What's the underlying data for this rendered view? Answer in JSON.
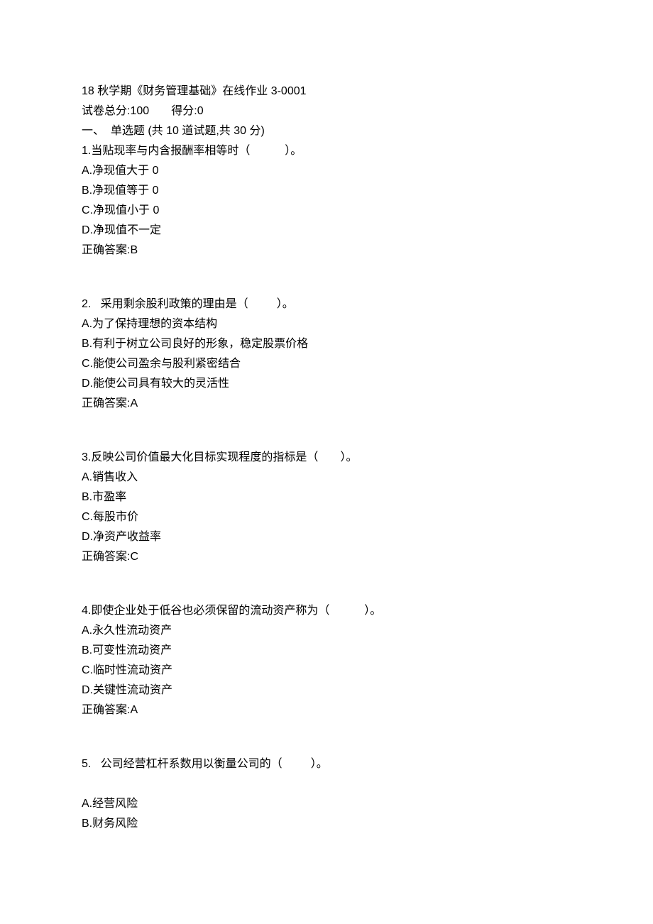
{
  "header": {
    "title": "18 秋学期《财务管理基础》在线作业 3-0001",
    "score_line": "试卷总分:100       得分:0",
    "section_line": "一、  单选题 (共 10 道试题,共 30 分)"
  },
  "questions": [
    {
      "stem": "1.当贴现率与内含报酬率相等时（           ）。",
      "options": [
        "A.净现值大于 0",
        "B.净现值等于 0",
        "C.净现值小于 0",
        "D.净现值不一定"
      ],
      "answer": "正确答案:B"
    },
    {
      "stem": "2.   采用剩余股利政策的理由是（         ）。",
      "options": [
        "A.为了保持理想的资本结构",
        "B.有利于树立公司良好的形象，稳定股票价格",
        "C.能使公司盈余与股利紧密结合",
        "D.能使公司具有较大的灵活性"
      ],
      "answer": "正确答案:A"
    },
    {
      "stem": "3.反映公司价值最大化目标实现程度的指标是（       ）。",
      "options": [
        "A.销售收入",
        "B.市盈率",
        "C.每股市价",
        "D.净资产收益率"
      ],
      "answer": "正确答案:C"
    },
    {
      "stem": "4.即使企业处于低谷也必须保留的流动资产称为（           ）。",
      "options": [
        "A.永久性流动资产",
        "B.可变性流动资产",
        "C.临时性流动资产",
        "D.关键性流动资产"
      ],
      "answer": "正确答案:A"
    },
    {
      "stem": "5.   公司经营杠杆系数用以衡量公司的（         ）。",
      "options": [
        "A.经营风险",
        "B.财务风险"
      ],
      "answer": ""
    }
  ]
}
